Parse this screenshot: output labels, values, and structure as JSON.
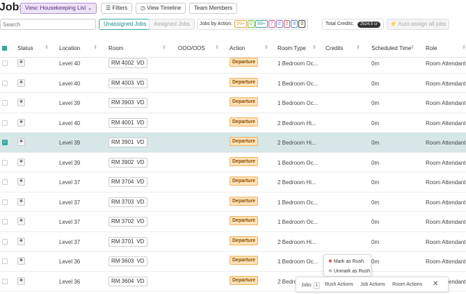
{
  "header": {
    "title": "Jobs",
    "view_label": "View: Housekeeping List",
    "filters_label": "Filters",
    "timeline_label": "View Timeline",
    "team_label": "Team Members"
  },
  "toolbar": {
    "search_placeholder": "Search",
    "tab_unassigned": "Unassigned Jobs",
    "tab_assigned": "Assigned Jobs",
    "jobs_by_action_label": "Jobs by Action:",
    "action_chips": [
      {
        "label": "99+",
        "color": "#f2a33a"
      },
      {
        "label": "0",
        "color": "#6cc04a"
      },
      {
        "label": "99+",
        "color": "#3aa6a0"
      },
      {
        "label": "7",
        "color": "#e05a8a"
      },
      {
        "label": "0",
        "color": "#8a7ad8"
      },
      {
        "label": "0",
        "color": "#d65a5a"
      },
      {
        "label": "8",
        "color": "#5a8ad6"
      },
      {
        "label": "0",
        "color": "#444444"
      }
    ],
    "total_credits_label": "Total Credits:",
    "total_credits_value": "2524.5 cr",
    "auto_assign_label": "Auto-assign all jobs"
  },
  "table": {
    "headers": {
      "status": "Status",
      "location": "Location",
      "room": "Room",
      "ooo": "OOO/OOS",
      "action": "Action",
      "room_type": "Room Type",
      "credits": "Credits",
      "scheduled": "Scheduled Time",
      "role": "Role"
    },
    "rows": [
      {
        "location": "Level 40",
        "room": "RM 4002",
        "code": "VD",
        "action": "Departure",
        "room_type": "1 Bedroom Oc...",
        "scheduled": "0m",
        "role": "Room Attendant",
        "selected": false
      },
      {
        "location": "Level 40",
        "room": "RM 4003",
        "code": "VD",
        "action": "Departure",
        "room_type": "1 Bedroom Oc...",
        "scheduled": "0m",
        "role": "Room Attendant",
        "selected": false
      },
      {
        "location": "Level 39",
        "room": "RM 3903",
        "code": "VD",
        "action": "Departure",
        "room_type": "1 Bedroom Oc...",
        "scheduled": "0m",
        "role": "Room Attendant",
        "selected": false
      },
      {
        "location": "Level 40",
        "room": "RM 4001",
        "code": "VD",
        "action": "Departure",
        "room_type": "2 Bedroom Hi...",
        "scheduled": "0m",
        "role": "Room Attendant",
        "selected": false
      },
      {
        "location": "Level 39",
        "room": "RM 3901",
        "code": "VD",
        "action": "Departure",
        "room_type": "2 Bedroom Hi...",
        "scheduled": "0m",
        "role": "Room Attendant",
        "selected": true
      },
      {
        "location": "Level 39",
        "room": "RM 3902",
        "code": "VD",
        "action": "Departure",
        "room_type": "1 Bedroom Oc...",
        "scheduled": "0m",
        "role": "Room Attendant",
        "selected": false
      },
      {
        "location": "Level 37",
        "room": "RM 3704",
        "code": "VD",
        "action": "Departure",
        "room_type": "2 Bedroom Hi...",
        "scheduled": "0m",
        "role": "Room Attendant",
        "selected": false
      },
      {
        "location": "Level 37",
        "room": "RM 3703",
        "code": "VD",
        "action": "Departure",
        "room_type": "1 Bedroom Oc...",
        "scheduled": "0m",
        "role": "Room Attendant",
        "selected": false
      },
      {
        "location": "Level 37",
        "room": "RM 3702",
        "code": "VD",
        "action": "Departure",
        "room_type": "1 Bedroom Oc...",
        "scheduled": "0m",
        "role": "Room Attendant",
        "selected": false
      },
      {
        "location": "Level 37",
        "room": "RM 3701",
        "code": "VD",
        "action": "Departure",
        "room_type": "2 Bedroom Hi...",
        "scheduled": "0m",
        "role": "Room Attendant",
        "selected": false
      },
      {
        "location": "Level 36",
        "room": "RM 3603",
        "code": "VD",
        "action": "Departure",
        "room_type": "1 Bedroom Oc...",
        "scheduled": "0m",
        "role": "Room Attendant",
        "selected": false
      },
      {
        "location": "Level 36",
        "room": "RM 3604",
        "code": "VD",
        "action": "Departure",
        "room_type": "2 Bedro",
        "scheduled": "",
        "role": "Room Attendant",
        "selected": false
      }
    ]
  },
  "rush_menu": {
    "mark": "Mark as Rush",
    "unmark": "Unmark as Rush"
  },
  "bottom_bar": {
    "jobs_label": "Jobs",
    "jobs_count": "1",
    "rush_actions": "Rush Actions",
    "job_actions": "Job Actions",
    "room_actions": "Room Actions"
  }
}
